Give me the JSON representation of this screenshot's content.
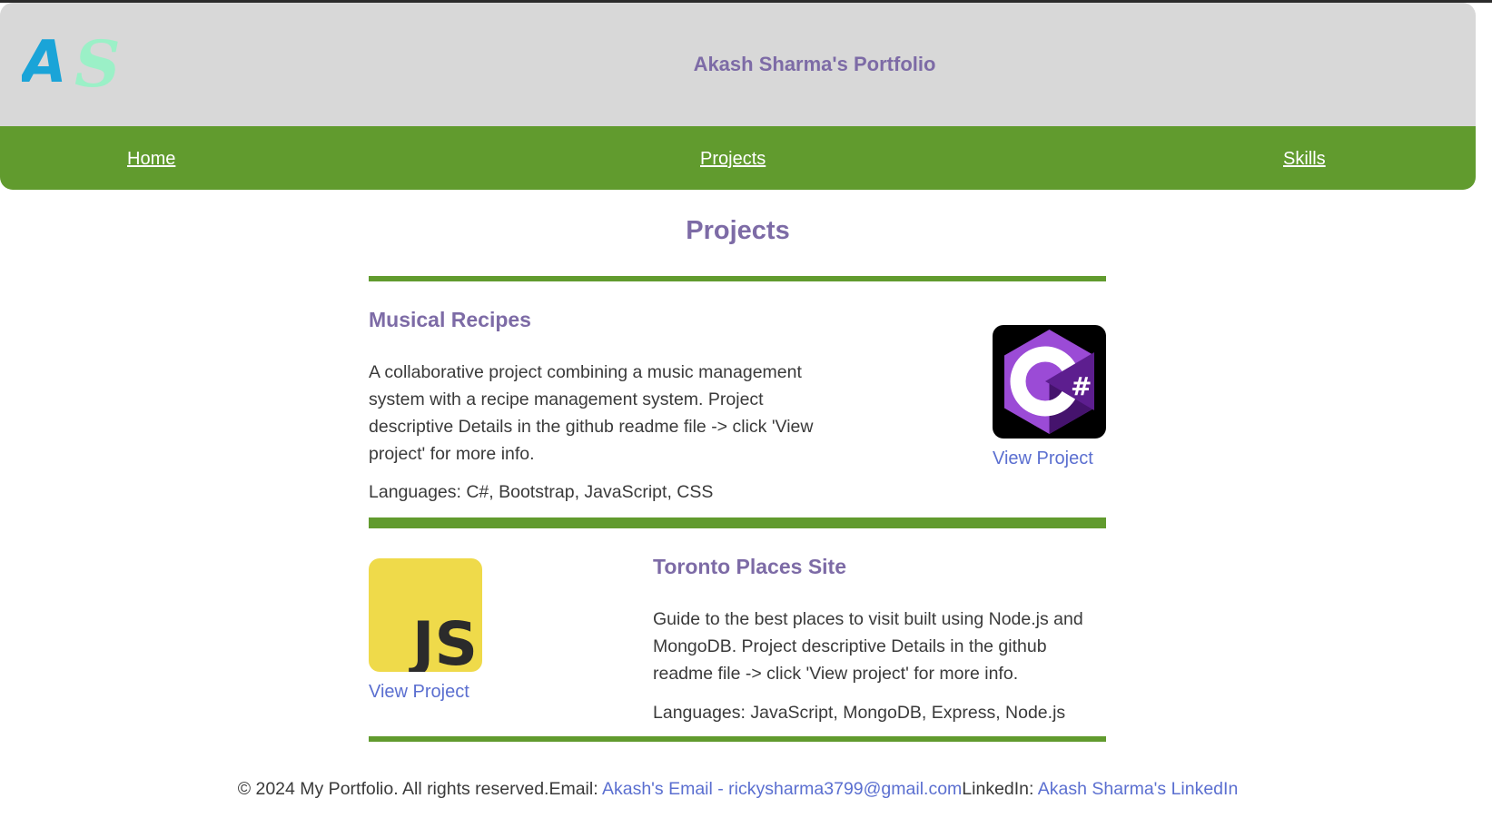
{
  "header": {
    "logo_text": "AS",
    "title": "Akash Sharma's Portfolio"
  },
  "nav": {
    "items": [
      {
        "label": "Home"
      },
      {
        "label": "Projects"
      },
      {
        "label": "Skills"
      }
    ]
  },
  "main": {
    "title": "Projects",
    "projects": [
      {
        "title": "Musical Recipes",
        "description": "A collaborative project combining a music management system with a recipe management system. Project descriptive Details in the github readme file -> click 'View project' for more info.",
        "languages": "Languages: C#, Bootstrap, JavaScript, CSS",
        "icon": "csharp-logo-icon",
        "link_label": "View Project"
      },
      {
        "title": "Toronto Places Site",
        "description": "Guide to the best places to visit built using Node.js and MongoDB. Project descriptive Details in the github readme file -> click 'View project' for more info.",
        "languages": "Languages: JavaScript, MongoDB, Express, Node.js",
        "icon": "javascript-logo-icon",
        "icon_text": "JS",
        "link_label": "View Project"
      }
    ]
  },
  "footer": {
    "copyright": "© 2024 My Portfolio. All rights reserved.",
    "email_prefix": "Email: ",
    "email_link": "Akash's Email - rickysharma3799@gmail.com",
    "linkedin_prefix": "LinkedIn: ",
    "linkedin_link": "Akash Sharma's LinkedIn"
  },
  "colors": {
    "accent_green": "#619b2e",
    "heading_purple": "#7d6ba6",
    "link_blue": "#5b6fd0",
    "header_gray": "#d8d8d8",
    "js_yellow": "#efda4a",
    "csharp_purple": "#68217a"
  }
}
